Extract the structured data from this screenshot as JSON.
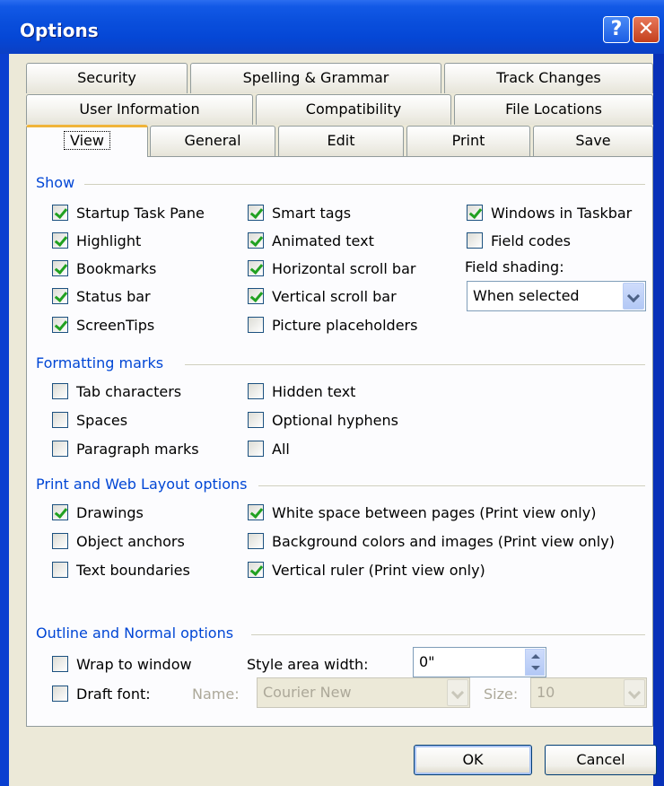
{
  "window": {
    "title": "Options",
    "help_glyph": "?",
    "close_glyph": "✕"
  },
  "tabs": {
    "row1": [
      "Security",
      "Spelling & Grammar",
      "Track Changes"
    ],
    "row2": [
      "User Information",
      "Compatibility",
      "File Locations"
    ],
    "row3": [
      "View",
      "General",
      "Edit",
      "Print",
      "Save"
    ],
    "active": "View"
  },
  "show": {
    "heading": "Show",
    "items": [
      {
        "label": "Startup Task Pane",
        "checked": true
      },
      {
        "label": "Highlight",
        "checked": true
      },
      {
        "label": "Bookmarks",
        "checked": true
      },
      {
        "label": "Status bar",
        "checked": true
      },
      {
        "label": "ScreenTips",
        "checked": true
      },
      {
        "label": "Smart tags",
        "checked": true
      },
      {
        "label": "Animated text",
        "checked": true
      },
      {
        "label": "Horizontal scroll bar",
        "checked": true
      },
      {
        "label": "Vertical scroll bar",
        "checked": true
      },
      {
        "label": "Picture placeholders",
        "checked": false
      },
      {
        "label": "Windows in Taskbar",
        "checked": true
      },
      {
        "label": "Field codes",
        "checked": false
      }
    ],
    "field_shading_label": "Field shading:",
    "field_shading_value": "When selected"
  },
  "formatting": {
    "heading": "Formatting marks",
    "items": [
      {
        "label": "Tab characters",
        "checked": false
      },
      {
        "label": "Spaces",
        "checked": false
      },
      {
        "label": "Paragraph marks",
        "checked": false
      },
      {
        "label": "Hidden text",
        "checked": false
      },
      {
        "label": "Optional hyphens",
        "checked": false
      },
      {
        "label": "All",
        "checked": false
      }
    ]
  },
  "printweb": {
    "heading": "Print and Web Layout options",
    "items": [
      {
        "label": "Drawings",
        "checked": true
      },
      {
        "label": "Object anchors",
        "checked": false
      },
      {
        "label": "Text boundaries",
        "checked": false
      },
      {
        "label": "White space between pages (Print view only)",
        "checked": true
      },
      {
        "label": "Background colors and images (Print view only)",
        "checked": false
      },
      {
        "label": "Vertical ruler (Print view only)",
        "checked": true
      }
    ]
  },
  "outline": {
    "heading": "Outline and Normal options",
    "wrap": {
      "label": "Wrap to window",
      "checked": false
    },
    "draft": {
      "label": "Draft font:",
      "checked": false
    },
    "style_area_label": "Style area width:",
    "style_area_value": "0\"",
    "name_label": "Name:",
    "name_value": "Courier New",
    "size_label": "Size:",
    "size_value": "10"
  },
  "buttons": {
    "ok": "OK",
    "cancel": "Cancel"
  }
}
